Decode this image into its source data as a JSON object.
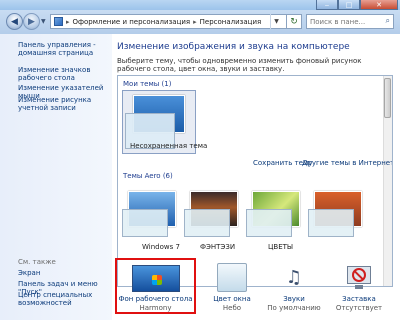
{
  "address": {
    "path": [
      "Оформление и персонализация",
      "Персонализация"
    ],
    "search_placeholder": "Поиск в пане..."
  },
  "sidebar": {
    "links": [
      "Панель управления - домашняя страница",
      "Изменение значков рабочего стола",
      "Изменение указателей мыши",
      "Изменение рисунка учетной записи"
    ],
    "see_also_label": "См. также",
    "see_also": [
      "Экран",
      "Панель задач и меню \"Пуск\"",
      "Центр специальных возможностей"
    ]
  },
  "main": {
    "heading": "Изменение изображения и звука на компьютере",
    "intro": "Выберите тему, чтобы одновременно изменить фоновый рисунок рабочего стола, цвет окна, звуки и заставку.",
    "my_themes_label": "Мои темы (1)",
    "unsaved_theme_label": "Несохраненная тема",
    "save_theme_link": "Сохранить тему",
    "online_themes_link": "Другие темы в Интернете",
    "aero_themes_label": "Темы Aero (6)",
    "aero_themes": [
      "Windows 7",
      "ФЭНТЭЗИ",
      "ЦВЕТЫ"
    ]
  },
  "tiles": {
    "background": {
      "label": "Фон рабочего стола",
      "value": "Harmony"
    },
    "color": {
      "label": "Цвет окна",
      "value": "Небо"
    },
    "sounds": {
      "label": "Звуки",
      "value": "По умолчанию"
    },
    "screensaver": {
      "label": "Заставка",
      "value": "Отсутствует"
    }
  },
  "colors": {
    "highlight_outline": "#e01010",
    "link": "#0b3a7a",
    "heading": "#1e3d8f"
  }
}
